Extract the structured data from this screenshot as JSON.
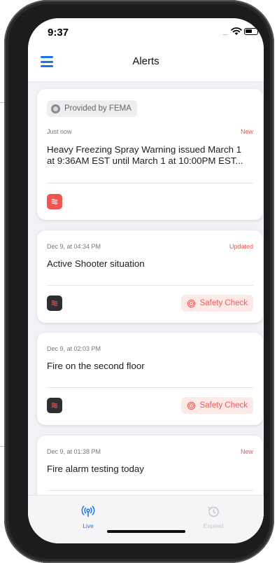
{
  "status_bar": {
    "time": "9:37",
    "signal": "....."
  },
  "header": {
    "title": "Alerts",
    "menu_icon": "hamburger-menu-icon"
  },
  "alerts": [
    {
      "provider": "Provided by FEMA",
      "timestamp": "Just now",
      "tag": "New",
      "message_line1": "Heavy Freezing Spray Warning issued March 1",
      "message_line2": "at 9:36AM EST until March 1 at 10:00PM EST...",
      "icon": "alert-waves-icon",
      "icon_color": "#f0554f"
    },
    {
      "timestamp": "Dec 9, at 04:34 PM",
      "tag": "Updated",
      "message": "Active Shooter situation",
      "icon": "alert-waves-icon",
      "icon_color": "#2f2f33",
      "action": "Safety Check"
    },
    {
      "timestamp": "Dec 9, at 02:03 PM",
      "message": "Fire on the second floor",
      "icon": "alert-waves-icon",
      "icon_color": "#2f2f33",
      "action": "Safety Check"
    },
    {
      "timestamp": "Dec 9, at 01:38 PM",
      "tag": "New",
      "message": "Fire alarm testing today"
    }
  ],
  "tabs": [
    {
      "label": "Live",
      "icon": "broadcast-icon",
      "active": true
    },
    {
      "label": "Expired",
      "icon": "history-icon",
      "active": false
    }
  ],
  "colors": {
    "accent": "#1a73e8",
    "alert_red": "#f0554f",
    "inactive": "#c7c7cc"
  }
}
